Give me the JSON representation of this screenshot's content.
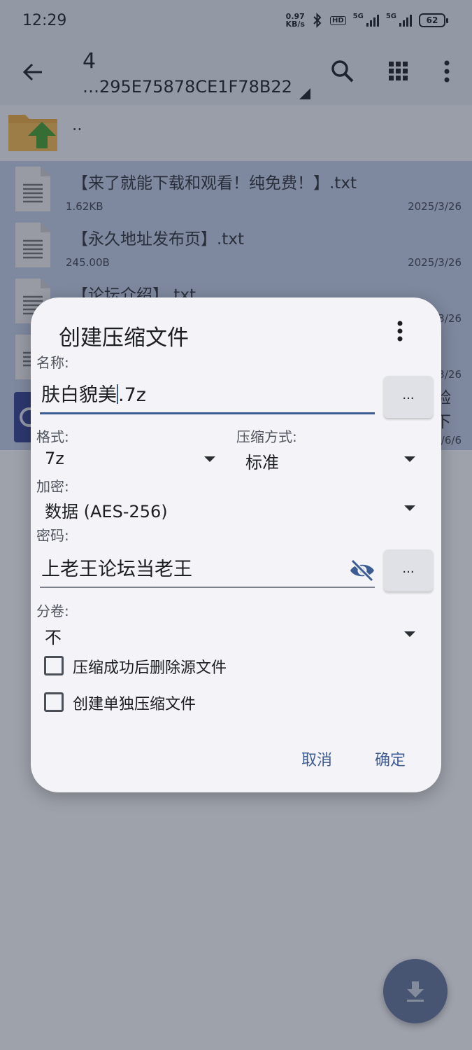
{
  "status_bar": {
    "time": "12:29",
    "net_speed_value": "0.97",
    "net_speed_unit": "KB/s",
    "hd_label": "HD",
    "sig1_label": "5G",
    "sig2_label": "5G",
    "battery": "62"
  },
  "toolbar": {
    "title": "4",
    "subtitle": "…295E75878CE1F78B22"
  },
  "file_list": {
    "up_label": "..",
    "items": [
      {
        "name": "【来了就能下载和观看！纯免费！】.txt",
        "size": "1.62KB",
        "date": "2025/3/26"
      },
      {
        "name": "【永久地址发布页】.txt",
        "size": "245.00B",
        "date": "2025/3/26"
      },
      {
        "name": "【论坛介绍】.txt",
        "size": "",
        "date": "2025/3/26"
      },
      {
        "name": "",
        "size": "",
        "date": "2025/3/26"
      },
      {
        "name": "",
        "size": "",
        "date": "2025/6/6",
        "right_text": "验\n下"
      }
    ]
  },
  "dialog": {
    "title": "创建压缩文件",
    "name_label": "名称:",
    "name_before_cursor": "肤白貌美",
    "name_after_cursor": ".7z",
    "browse_label": "...",
    "format_label": "格式:",
    "format_value": "7z",
    "method_label": "压缩方式:",
    "method_value": "标准",
    "encryption_label": "加密:",
    "encryption_value": "数据 (AES-256)",
    "password_label": "密码:",
    "password_value": "上老王论坛当老王",
    "password_more_label": "...",
    "split_label": "分卷:",
    "split_value": "不",
    "delete_source_label": "压缩成功后删除源文件",
    "separate_archive_label": "创建单独压缩文件",
    "cancel_label": "取消",
    "ok_label": "确定"
  },
  "colors": {
    "accent": "#3d5c94",
    "selected_row": "#bcc8e2",
    "fab": "#5e7196"
  }
}
